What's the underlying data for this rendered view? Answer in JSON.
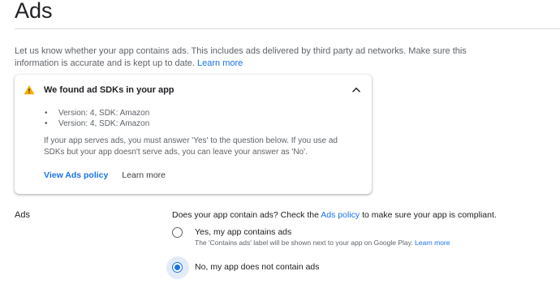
{
  "page": {
    "title": "Ads",
    "intro_text": "Let us know whether your app contains ads. This includes ads delivered by third party ad networks. Make sure this information is accurate and is kept up to date.",
    "intro_link": "Learn more"
  },
  "notice": {
    "icon": "warning-icon",
    "title": "We found ad SDKs in your app",
    "sdks": [
      "Version: 4, SDK: Amazon",
      "Version: 4, SDK: Amazon"
    ],
    "body": "If your app serves ads, you must answer 'Yes' to the question below. If you use ad SDKs but your app doesn't serve ads, you can leave your answer as 'No'.",
    "primary_action": "View Ads policy",
    "secondary_action": "Learn more"
  },
  "question": {
    "section_label": "Ads",
    "text_before": "Does your app contain ads? Check the",
    "policy_link": "Ads policy",
    "text_after": "to make sure your app is compliant.",
    "options": [
      {
        "label": "Yes, my app contains ads",
        "help": "The 'Contains ads' label will be shown next to your app on Google Play.",
        "help_link": "Learn more",
        "selected": false
      },
      {
        "label": "No, my app does not contain ads",
        "selected": true
      }
    ]
  },
  "colors": {
    "accent": "#1a73e8",
    "warning": "#f9ab00",
    "muted_text": "#5f6368"
  }
}
